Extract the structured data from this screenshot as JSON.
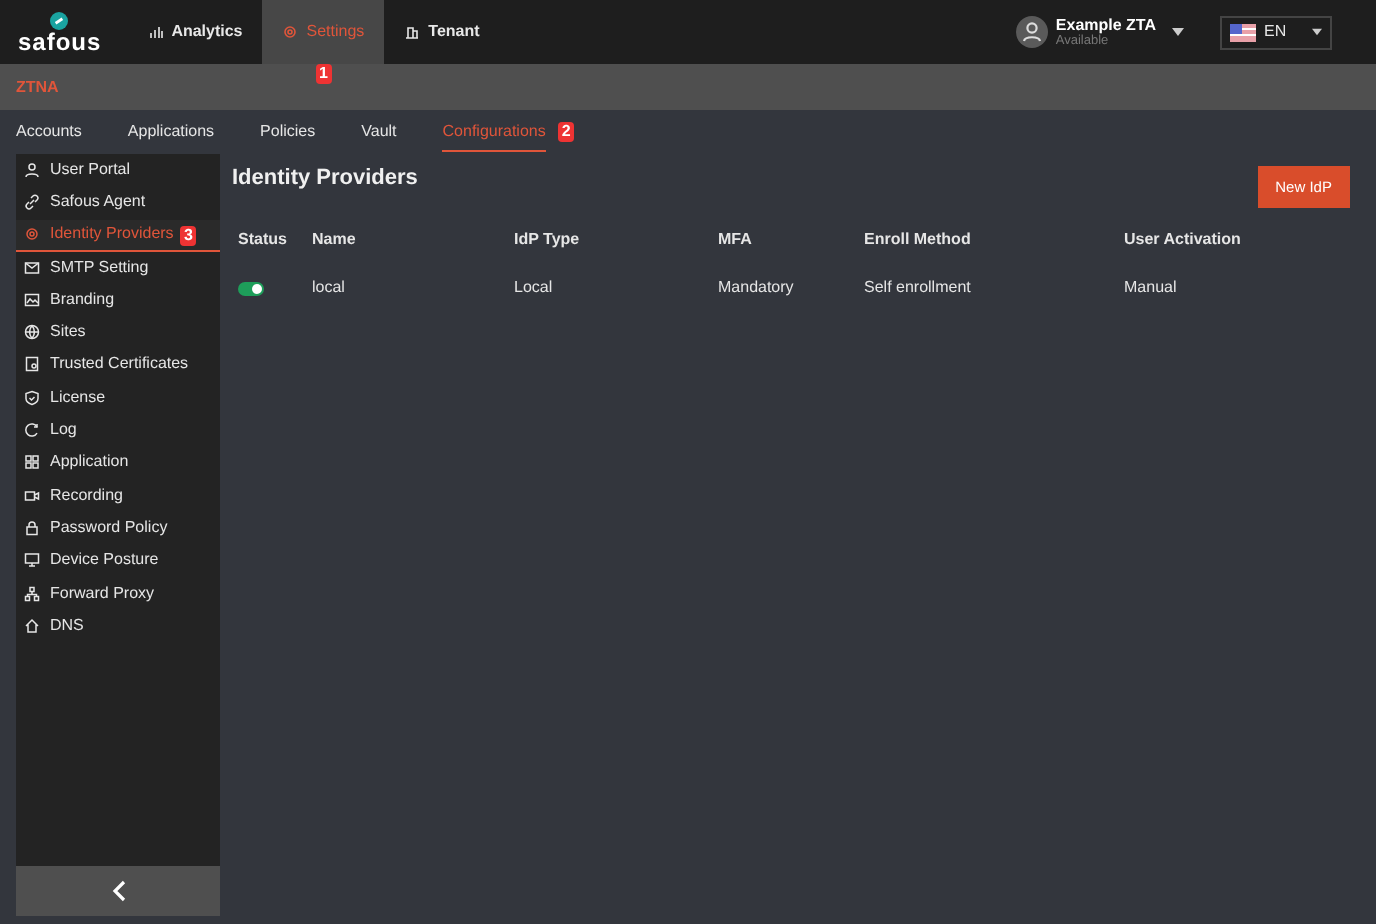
{
  "brand": {
    "name": "safous"
  },
  "nav": [
    {
      "label": "Analytics",
      "selected": false
    },
    {
      "label": "Settings",
      "selected": true,
      "marker": "1"
    },
    {
      "label": "Tenant",
      "selected": false
    }
  ],
  "user": {
    "name": "Example ZTA",
    "status": "Available"
  },
  "language": {
    "value": "EN"
  },
  "section": {
    "title": "ZTNA"
  },
  "tabs": [
    {
      "label": "Accounts",
      "selected": false
    },
    {
      "label": "Applications",
      "selected": false
    },
    {
      "label": "Policies",
      "selected": false
    },
    {
      "label": "Vault",
      "selected": false
    },
    {
      "label": "Configurations",
      "selected": true,
      "marker": "2"
    }
  ],
  "sidebar": {
    "items": [
      {
        "label": "User Portal",
        "selected": false
      },
      {
        "label": "Safous Agent",
        "selected": false
      },
      {
        "label": "Identity Providers",
        "selected": true,
        "marker": "3"
      },
      {
        "label": "SMTP Setting",
        "selected": false
      },
      {
        "label": "Branding",
        "selected": false
      },
      {
        "label": "Sites",
        "selected": false
      },
      {
        "label": "Trusted Certificates",
        "selected": false
      },
      {
        "label": "License",
        "selected": false
      },
      {
        "label": "Log",
        "selected": false
      },
      {
        "label": "Application",
        "selected": false
      },
      {
        "label": "Recording",
        "selected": false
      },
      {
        "label": "Password Policy",
        "selected": false
      },
      {
        "label": "Device Posture",
        "selected": false
      },
      {
        "label": "Forward Proxy",
        "selected": false
      },
      {
        "label": "DNS",
        "selected": false
      }
    ]
  },
  "page": {
    "title": "Identity Providers",
    "action": "New IdP"
  },
  "table": {
    "columns": [
      "Status",
      "Name",
      "IdP Type",
      "MFA",
      "Enroll Method",
      "User Activation"
    ],
    "rows": [
      {
        "on": true,
        "cells": [
          "",
          "local",
          "Local",
          "Mandatory",
          "Self enrollment",
          "Manual"
        ]
      }
    ]
  }
}
